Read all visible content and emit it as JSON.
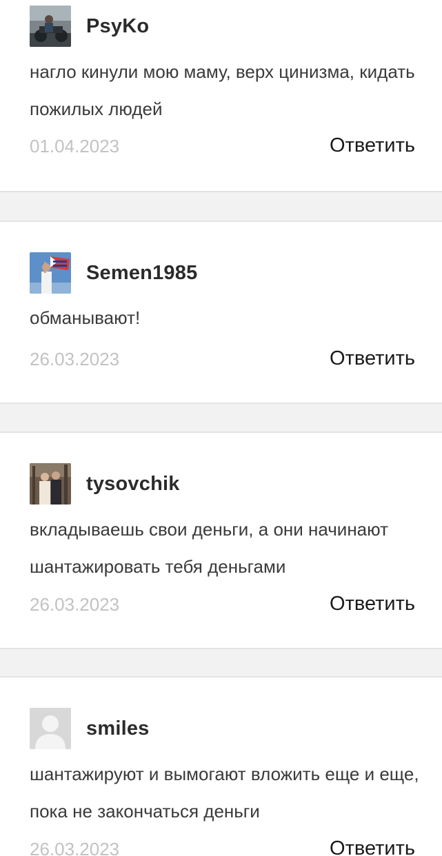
{
  "comments": [
    {
      "username": "PsyKo",
      "avatar_icon": "user-photo-motorcycle",
      "text": "нагло кинули мою маму, верх цинизма, кидать пожилых людей",
      "date": "01.04.2023",
      "reply_label": "Ответить"
    },
    {
      "username": "Semen1985",
      "avatar_icon": "user-photo-flag",
      "text": "обманывают!",
      "date": "26.03.2023",
      "reply_label": "Ответить"
    },
    {
      "username": "tysovchik",
      "avatar_icon": "user-photo-couple",
      "text": "вкладываешь свои деньги, а они начинают шантажировать тебя деньгами",
      "date": "26.03.2023",
      "reply_label": "Ответить"
    },
    {
      "username": "smiles",
      "avatar_icon": "default-avatar-icon",
      "text": "шантажируют и вымогают вложить еще и еще, пока не закончаться деньги",
      "date": "26.03.2023",
      "reply_label": "Ответить"
    }
  ],
  "colors": {
    "background": "#f2f2f2",
    "card": "#ffffff",
    "date": "#c2c2c2",
    "username": "#2b2b2b"
  }
}
